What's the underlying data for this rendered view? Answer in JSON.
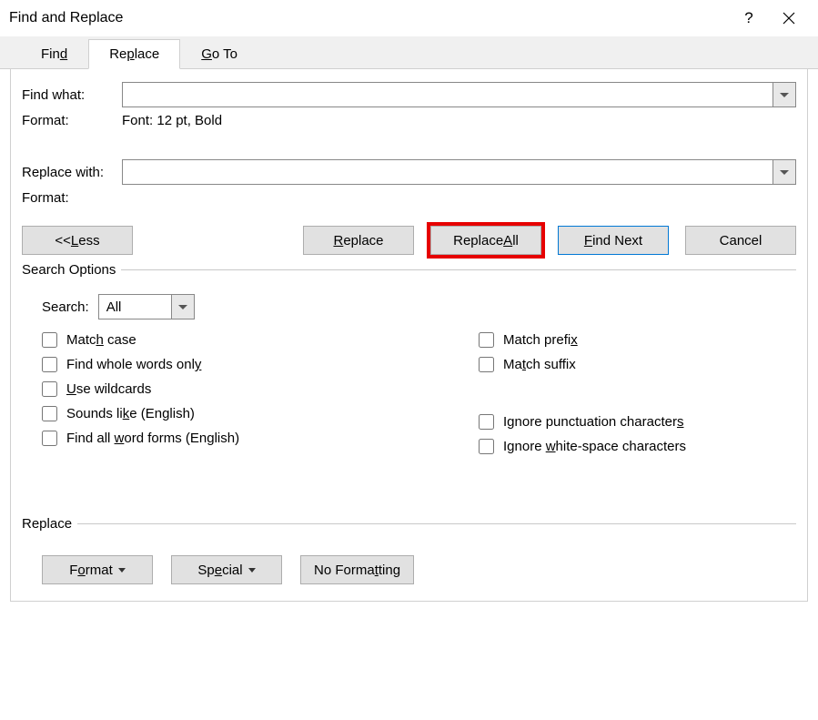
{
  "title": "Find and Replace",
  "tabs": {
    "find": {
      "pre": "Fin",
      "ul": "d",
      "post": ""
    },
    "replace": {
      "pre": "Re",
      "ul": "p",
      "post": "lace"
    },
    "goto": {
      "pre": "",
      "ul": "G",
      "post": "o To"
    }
  },
  "labels": {
    "find_what": "Find what:",
    "format": "Format:",
    "format_value": "Font: 12 pt, Bold",
    "replace_with": "Replace with:",
    "format2": "Format:"
  },
  "inputs": {
    "find_value": "",
    "replace_value": ""
  },
  "buttons": {
    "less": {
      "pre": "<< ",
      "ul": "L",
      "post": "ess"
    },
    "replace": {
      "pre": "",
      "ul": "R",
      "post": "eplace"
    },
    "replace_all": {
      "pre": "Replace ",
      "ul": "A",
      "post": "ll"
    },
    "find_next": {
      "pre": "",
      "ul": "F",
      "post": "ind Next"
    },
    "cancel": "Cancel"
  },
  "search_options": {
    "legend": "Search Options",
    "search_label": "Search:",
    "search_value": "All",
    "left": {
      "match_case": {
        "pre": "Matc",
        "ul": "h",
        "post": " case"
      },
      "whole_words": {
        "pre": "Find whole words onl",
        "ul": "y",
        "post": ""
      },
      "wildcards": {
        "pre": "",
        "ul": "U",
        "post": "se wildcards"
      },
      "sounds_like": {
        "pre": "Sounds li",
        "ul": "k",
        "post": "e (English)"
      },
      "word_forms": {
        "pre": "Find all ",
        "ul": "w",
        "post": "ord forms (English)"
      }
    },
    "right": {
      "match_prefix": {
        "pre": "Match prefi",
        "ul": "x",
        "post": ""
      },
      "match_suffix": {
        "pre": "Ma",
        "ul": "t",
        "post": "ch suffix"
      },
      "ignore_punct": {
        "pre": "Ignore punctuation character",
        "ul": "s",
        "post": ""
      },
      "ignore_ws": {
        "pre": "Ignore ",
        "ul": "w",
        "post": "hite-space characters"
      }
    }
  },
  "replace_group": {
    "legend": "Replace",
    "format": {
      "pre": "F",
      "ul": "o",
      "post": "rmat"
    },
    "special": {
      "pre": "Sp",
      "ul": "e",
      "post": "cial"
    },
    "no_formatting": {
      "pre": "No Forma",
      "ul": "t",
      "post": "ting"
    }
  }
}
